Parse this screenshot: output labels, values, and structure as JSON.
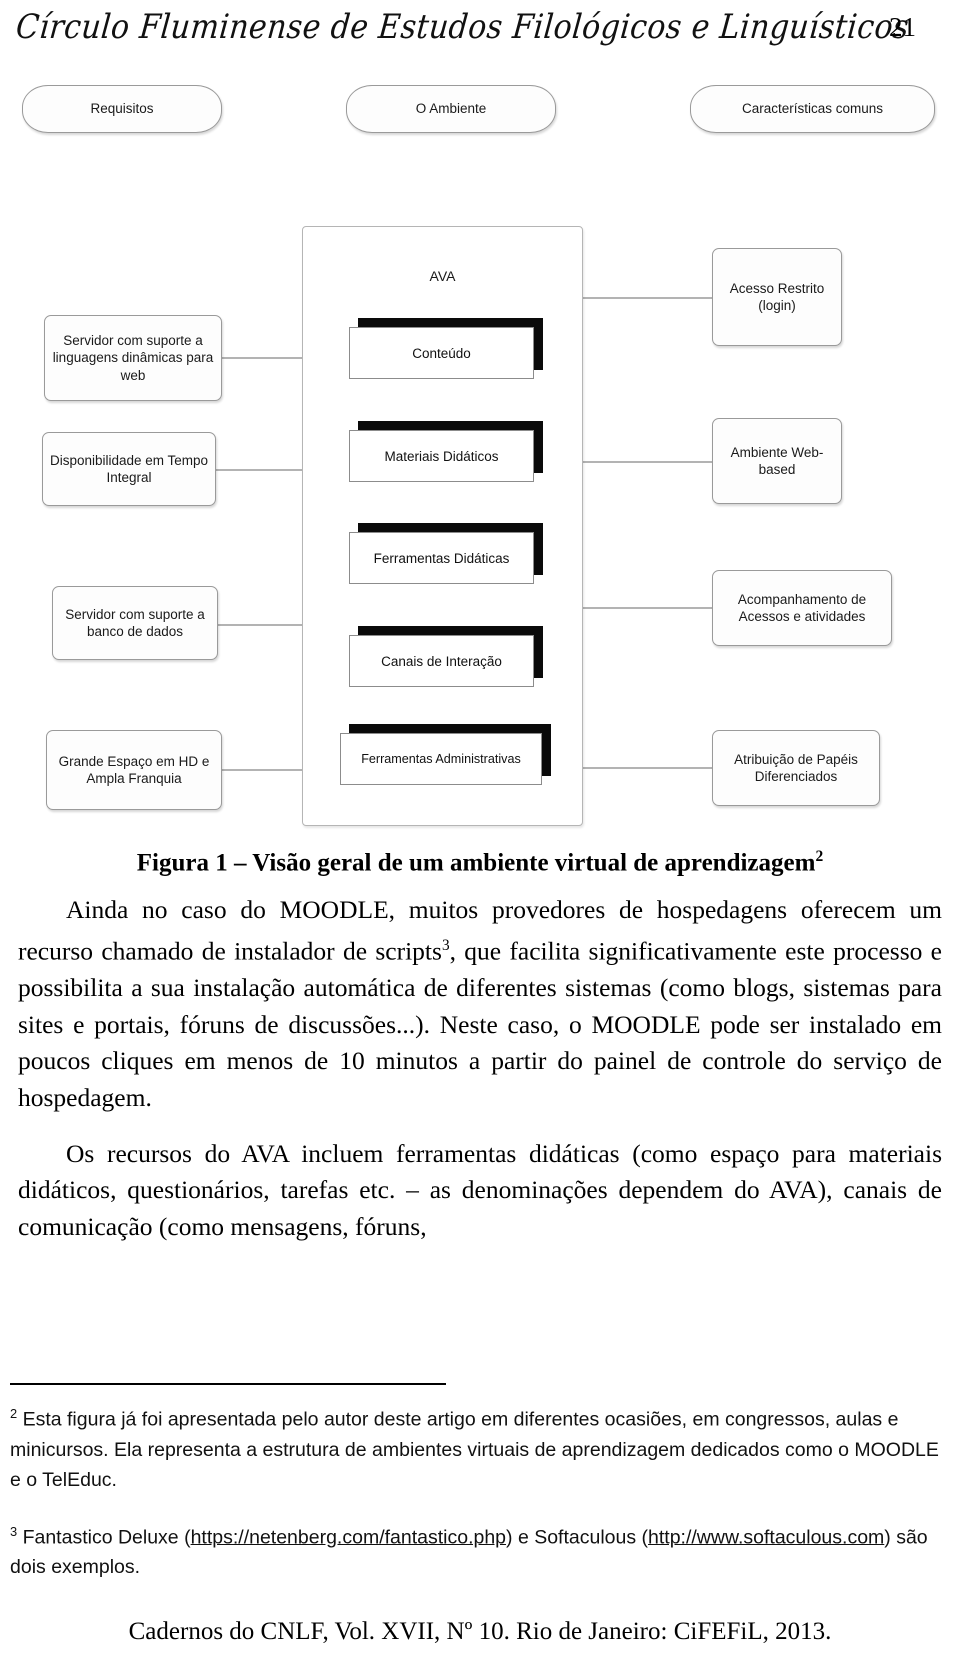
{
  "running_head": {
    "journal": "Círculo Fluminense de Estudos Filológicos e Linguísticos",
    "page_number": "21"
  },
  "figure": {
    "headers": [
      {
        "label": "Requisitos"
      },
      {
        "label": "O Ambiente"
      },
      {
        "label": "Características comuns"
      }
    ],
    "ava_label": "AVA",
    "left_nodes": [
      {
        "label": "Servidor com suporte a linguagens dinâmicas para web"
      },
      {
        "label": "Disponibilidade em Tempo Integral"
      },
      {
        "label": "Servidor com suporte a banco de dados"
      },
      {
        "label": "Grande Espaço em HD e Ampla Franquia"
      }
    ],
    "center_nodes": [
      {
        "label": "Conteúdo"
      },
      {
        "label": "Materiais Didáticos"
      },
      {
        "label": "Ferramentas Didáticas"
      },
      {
        "label": "Canais de Interação"
      },
      {
        "label": "Ferramentas Administrativas"
      }
    ],
    "right_nodes": [
      {
        "label": "Acesso Restrito (login)"
      },
      {
        "label": "Ambiente Web-based"
      },
      {
        "label": "Acompanhamento de Acessos e atividades"
      },
      {
        "label": "Atribuição de Papéis Diferenciados"
      }
    ],
    "caption_text": "Figura 1 – Visão geral de um ambiente virtual de aprendizagem",
    "caption_footnote_marker": "2"
  },
  "body": {
    "paragraph1_a": "Ainda no caso do MOODLE, muitos provedores de hospedagens oferecem um recurso chamado de instalador de scripts",
    "paragraph1_marker": "3",
    "paragraph1_b": ", que facilita significativamente este processo e possibilita a sua instalação automática de diferentes sistemas (como blogs, sistemas para sites e portais, fóruns de discussões...). Neste caso, o MOODLE pode ser instalado em poucos cliques em menos de 10 minutos a partir do painel de controle do serviço de hospedagem.",
    "paragraph2": "Os recursos do AVA incluem ferramentas didáticas (como espaço para materiais didáticos, questionários, tarefas etc. – as denominações dependem do AVA), canais de comunicação (como mensagens, fóruns,"
  },
  "footnotes": {
    "fn2_marker": "2",
    "fn2_text": "Esta figura já foi apresentada pelo autor deste artigo em diferentes ocasiões, em congressos, aulas e minicursos. Ela representa a estrutura de ambientes virtuais de aprendizagem dedicados como o MOODLE e o TelEduc.",
    "fn3_marker": "3",
    "fn3_pre": "Fantastico Deluxe (",
    "fn3_url1": "https://netenberg.com/fantastico.php",
    "fn3_mid": ") e Softaculous (",
    "fn3_url2": "http://www.softaculous.com",
    "fn3_post": ") são dois exemplos."
  },
  "colophon": {
    "text": "Cadernos do CNLF, Vol. XVII, Nº 10. Rio de Janeiro: CiFEFiL, 2013."
  }
}
